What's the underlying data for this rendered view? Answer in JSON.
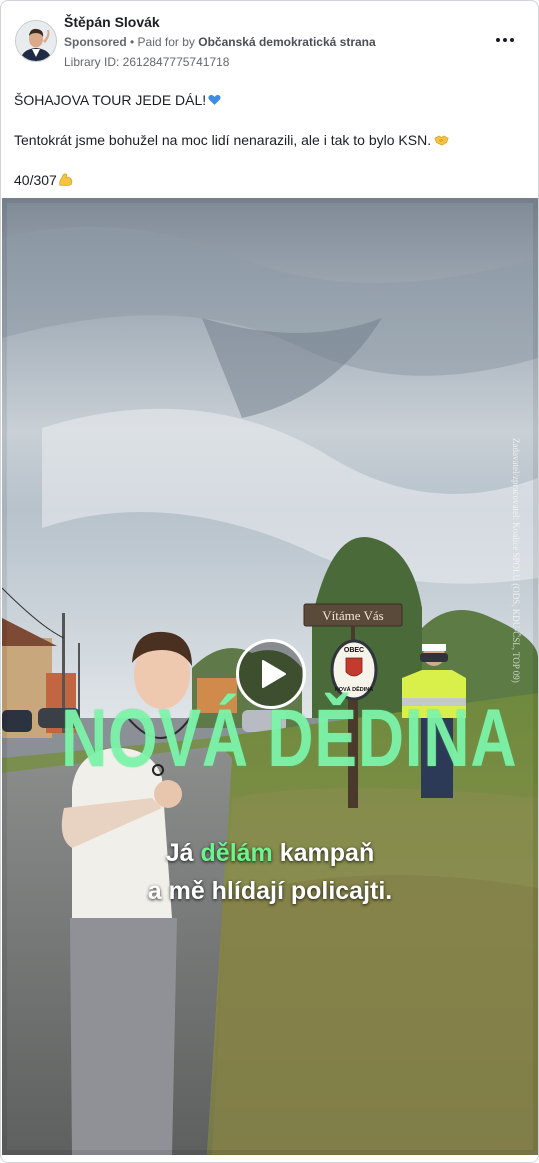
{
  "post": {
    "author": "Štěpán Slovák",
    "sponsored": "Sponsored",
    "separator": " • ",
    "paid_for_prefix": "Paid for by ",
    "paid_for_org": "Občanská demokratická strana",
    "library_id": "Library ID: 2612847775741718",
    "text_line1": "ŠOHAJOVA TOUR JEDE DÁL!",
    "text_line2": "Tentokrát jsme bohužel na moc lidí nenarazili, ale i tak to bylo KSN.",
    "text_line3": "40/307",
    "icons": {
      "more": "more-options-icon",
      "heart": "blue-heart-emoji",
      "handshake": "handshake-emoji",
      "arm": "flexed-biceps-emoji",
      "play": "play-icon"
    }
  },
  "video": {
    "overlay_title": "NOVÁ DĚDINA",
    "credit": "Zadavatel/zpracovatel: Koalice SPOLU (ODS, KDU-ČSL, TOP 09)",
    "sign_greeting": "Vítáme Vás",
    "sign_top": "OBEC",
    "sign_bottom": "NOVÁ DĚDINA",
    "subtitle_line1_a": "Já ",
    "subtitle_line1_highlight": "dělám",
    "subtitle_line1_b": " kampaň",
    "subtitle_line2": "a mě hlídají policajti.",
    "accent_color": "#7df4a9"
  }
}
